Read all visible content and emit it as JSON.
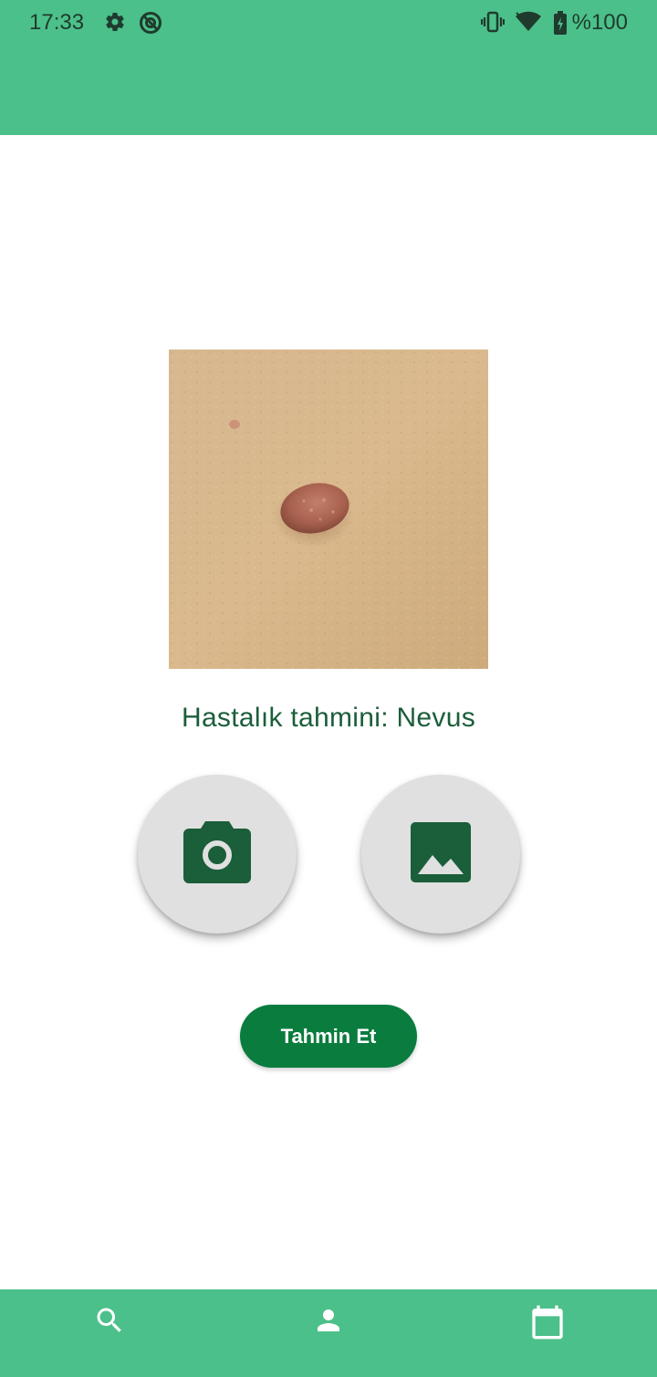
{
  "status_bar": {
    "time": "17:33",
    "battery_text": "%100",
    "left_icons": [
      "settings-icon",
      "sync-icon"
    ],
    "right_icons": [
      "vibrate-icon",
      "wifi-icon",
      "battery-charging-icon"
    ]
  },
  "colors": {
    "app_bar": "#4CC08A",
    "bottom_nav": "#4CC08A",
    "primary_button": "#0A7C3E",
    "icon_dark_green": "#1B5E3A",
    "fab_background": "#E0E0E0"
  },
  "preview_image": {
    "icon": "skin-lesion-photo"
  },
  "prediction": {
    "text": "Hastalık tahmini: Nevus"
  },
  "actions": {
    "camera_icon": "camera-icon",
    "gallery_icon": "image-icon",
    "predict_label": "Tahmin Et"
  },
  "bottom_nav": {
    "items": [
      {
        "icon": "search-icon"
      },
      {
        "icon": "person-icon"
      },
      {
        "icon": "calendar-icon"
      }
    ]
  }
}
